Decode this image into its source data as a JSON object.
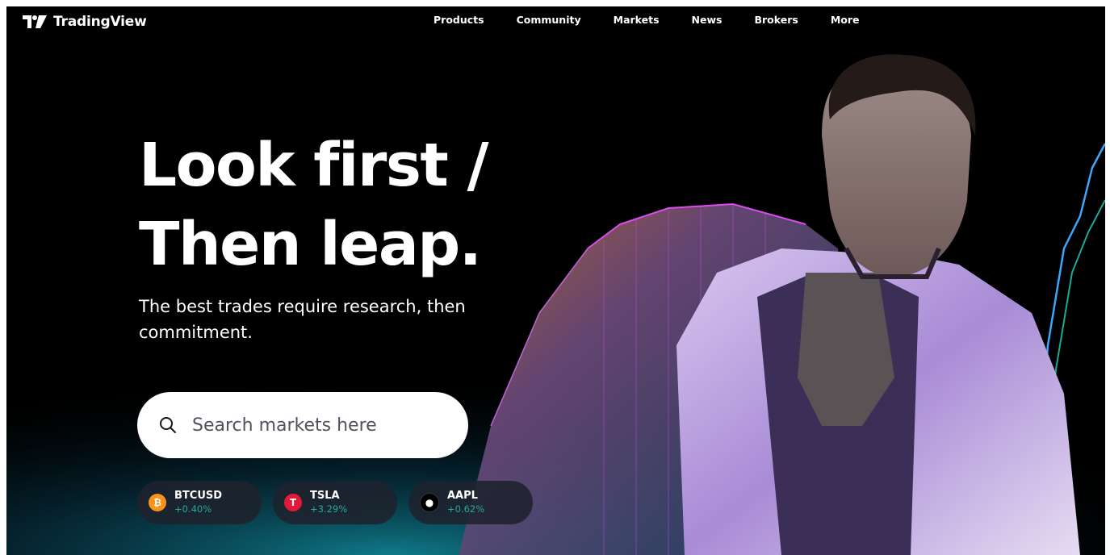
{
  "brand": {
    "name": "TradingView"
  },
  "nav": [
    {
      "label": "Products"
    },
    {
      "label": "Community"
    },
    {
      "label": "Markets"
    },
    {
      "label": "News"
    },
    {
      "label": "Brokers"
    },
    {
      "label": "More"
    }
  ],
  "hero": {
    "headline_line1": "Look first /",
    "headline_line2": "Then leap.",
    "subtext": "The best trades require research, then commitment."
  },
  "search": {
    "placeholder": "Search markets here",
    "icon": "search-icon"
  },
  "tickers": [
    {
      "symbol": "BTCUSD",
      "change": "+0.40%",
      "icon": "bitcoin-icon",
      "icon_color": "#f7931a"
    },
    {
      "symbol": "TSLA",
      "change": "+3.29%",
      "icon": "tesla-icon",
      "icon_color": "#e31937"
    },
    {
      "symbol": "AAPL",
      "change": "+0.62%",
      "icon": "apple-icon",
      "icon_color": "#000000"
    }
  ],
  "colors": {
    "background": "#000000",
    "positive": "#22ab94",
    "text": "#ffffff"
  }
}
